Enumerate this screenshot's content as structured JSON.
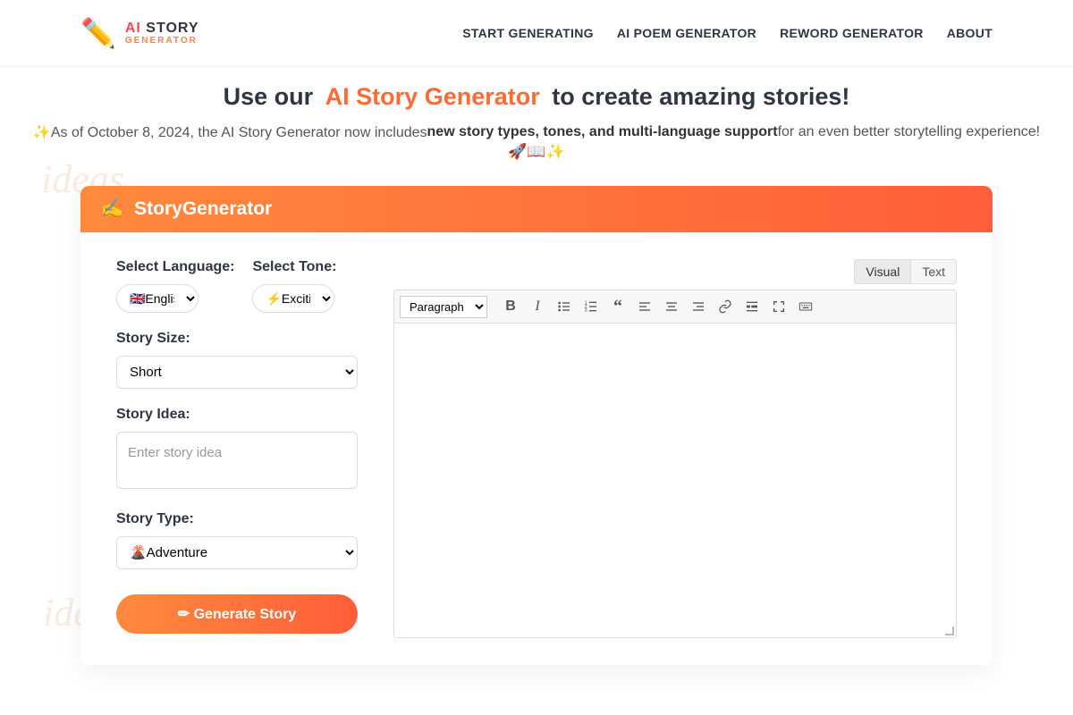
{
  "header": {
    "logo_main_ai": "AI",
    "logo_main_story": "STORY",
    "logo_sub": "GENERATOR",
    "nav": [
      "START GENERATING",
      "AI POEM GENERATOR",
      "REWORD GENERATOR",
      "ABOUT"
    ]
  },
  "hero": {
    "pre": "Use our ",
    "highlight": "AI Story Generator",
    "post": " to create amazing stories!",
    "announce_pre": "✨As of October 8, 2024, the AI Story Generator now includes ",
    "announce_bold": "new story types, tones, and multi-language support",
    "announce_post": " for an even better storytelling experience!",
    "emoji": "🚀📖✨"
  },
  "card": {
    "title_icon": "✍️",
    "title": "StoryGenerator"
  },
  "form": {
    "language_label": "Select Language:",
    "language_value": "🇬🇧English",
    "tone_label": "Select Tone:",
    "tone_value": "⚡Exciting",
    "size_label": "Story Size:",
    "size_value": "Short",
    "idea_label": "Story Idea:",
    "idea_placeholder": "Enter story idea",
    "type_label": "Story Type:",
    "type_value": "🌋Adventure",
    "generate": "✏ Generate Story"
  },
  "editor": {
    "tab_visual": "Visual",
    "tab_text": "Text",
    "format_select": "Paragraph"
  }
}
